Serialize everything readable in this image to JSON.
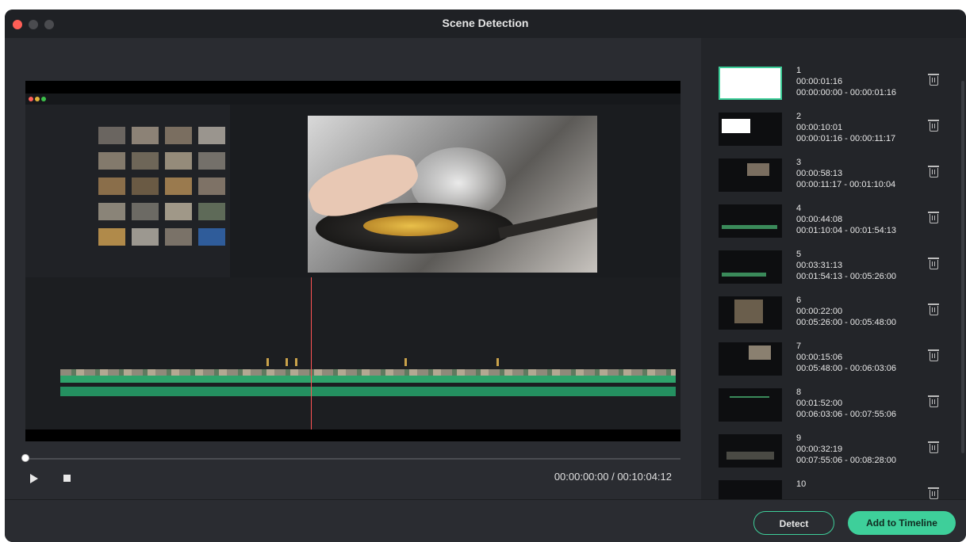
{
  "window": {
    "title": "Scene Detection"
  },
  "player": {
    "timecode": "00:00:00:00 / 00:10:04:12"
  },
  "scenes": [
    {
      "index": "1",
      "duration": "00:00:01:16",
      "range": "00:00:00:00 - 00:00:01:16"
    },
    {
      "index": "2",
      "duration": "00:00:10:01",
      "range": "00:00:01:16 - 00:00:11:17"
    },
    {
      "index": "3",
      "duration": "00:00:58:13",
      "range": "00:00:11:17 - 00:01:10:04"
    },
    {
      "index": "4",
      "duration": "00:00:44:08",
      "range": "00:01:10:04 - 00:01:54:13"
    },
    {
      "index": "5",
      "duration": "00:03:31:13",
      "range": "00:01:54:13 - 00:05:26:00"
    },
    {
      "index": "6",
      "duration": "00:00:22:00",
      "range": "00:05:26:00 - 00:05:48:00"
    },
    {
      "index": "7",
      "duration": "00:00:15:06",
      "range": "00:05:48:00 - 00:06:03:06"
    },
    {
      "index": "8",
      "duration": "00:01:52:00",
      "range": "00:06:03:06 - 00:07:55:06"
    },
    {
      "index": "9",
      "duration": "00:00:32:19",
      "range": "00:07:55:06 - 00:08:28:00"
    },
    {
      "index": "10",
      "duration": "",
      "range": ""
    }
  ],
  "footer": {
    "detect_label": "Detect",
    "add_label": "Add to Timeline"
  },
  "colors": {
    "accent": "#3ecf9a",
    "close": "#ff5f57",
    "background": "#2a2c31"
  }
}
